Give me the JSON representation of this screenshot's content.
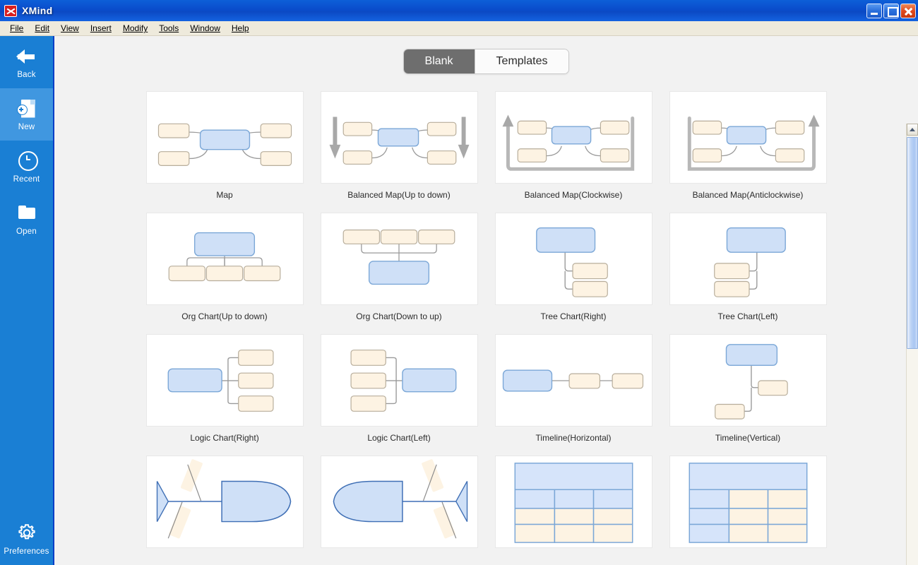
{
  "window": {
    "title": "XMind",
    "logo_icon": "xmind-logo-icon",
    "minimize_label": "Minimize",
    "maximize_label": "Maximize",
    "close_label": "Close"
  },
  "menubar": {
    "items": [
      {
        "label": "File",
        "accel": "F"
      },
      {
        "label": "Edit",
        "accel": "E"
      },
      {
        "label": "View",
        "accel": "V"
      },
      {
        "label": "Insert",
        "accel": "I"
      },
      {
        "label": "Modify",
        "accel": "M"
      },
      {
        "label": "Tools",
        "accel": "T"
      },
      {
        "label": "Window",
        "accel": "W"
      },
      {
        "label": "Help",
        "accel": "H"
      }
    ]
  },
  "sidebar": {
    "items": [
      {
        "label": "Back",
        "icon": "back-arrow-icon",
        "active": false
      },
      {
        "label": "New",
        "icon": "new-document-icon",
        "active": true
      },
      {
        "label": "Recent",
        "icon": "clock-icon",
        "active": false
      },
      {
        "label": "Open",
        "icon": "folder-icon",
        "active": false
      }
    ],
    "footer": {
      "label": "Preferences",
      "icon": "gear-icon"
    }
  },
  "tabs": {
    "items": [
      {
        "label": "Blank",
        "active": true
      },
      {
        "label": "Templates",
        "active": false
      }
    ]
  },
  "colors": {
    "accent_blue": "#1a7fd4",
    "node_blue_fill": "#cfe0f7",
    "node_blue_stroke": "#7ba7d7",
    "node_cream_fill": "#fdf3e3",
    "node_cream_stroke": "#b7ad9b",
    "connector": "#9a9a9a",
    "arrow_gray": "#a8a8a8",
    "tab_active_bg": "#6e6e6e",
    "canvas_bg": "#f2f2f2"
  },
  "templates": [
    {
      "id": "map",
      "label": "Map",
      "shape": "map"
    },
    {
      "id": "balanced-map-up-to-down",
      "label": "Balanced Map(Up to down)",
      "shape": "balanced-updown"
    },
    {
      "id": "balanced-map-clockwise",
      "label": "Balanced Map(Clockwise)",
      "shape": "balanced-cw"
    },
    {
      "id": "balanced-map-anticlock",
      "label": "Balanced Map(Anticlockwise)",
      "shape": "balanced-ccw"
    },
    {
      "id": "org-chart-up-to-down",
      "label": "Org Chart(Up to down)",
      "shape": "org-down"
    },
    {
      "id": "org-chart-down-to-up",
      "label": "Org Chart(Down to up)",
      "shape": "org-up"
    },
    {
      "id": "tree-chart-right",
      "label": "Tree Chart(Right)",
      "shape": "tree-right"
    },
    {
      "id": "tree-chart-left",
      "label": "Tree Chart(Left)",
      "shape": "tree-left"
    },
    {
      "id": "logic-chart-right",
      "label": "Logic Chart(Right)",
      "shape": "logic-right"
    },
    {
      "id": "logic-chart-left",
      "label": "Logic Chart(Left)",
      "shape": "logic-left"
    },
    {
      "id": "timeline-horizontal",
      "label": "Timeline(Horizontal)",
      "shape": "timeline-h"
    },
    {
      "id": "timeline-vertical",
      "label": "Timeline(Vertical)",
      "shape": "timeline-v"
    },
    {
      "id": "fishbone-right",
      "label": "",
      "shape": "fishbone-right"
    },
    {
      "id": "fishbone-left",
      "label": "",
      "shape": "fishbone-left"
    },
    {
      "id": "matrix-row-header",
      "label": "",
      "shape": "matrix-rows"
    },
    {
      "id": "matrix-col-header",
      "label": "",
      "shape": "matrix-cols"
    }
  ],
  "scrollbar": {
    "up_arrow": "chevron-up-icon",
    "position": "top"
  }
}
